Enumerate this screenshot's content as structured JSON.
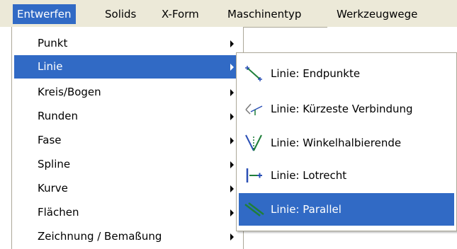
{
  "menubar": {
    "items": [
      {
        "label": "Entwerfen",
        "active": true
      },
      {
        "label": "Solids"
      },
      {
        "label": "X-Form"
      },
      {
        "label": "Maschinentyp"
      },
      {
        "label": "Werkzeugwege"
      }
    ]
  },
  "entwerfen_menu": {
    "items": [
      {
        "label": "Punkt",
        "has_submenu": true
      },
      {
        "label": "Linie",
        "has_submenu": true,
        "highlighted": true
      },
      {
        "label": "Kreis/Bogen",
        "has_submenu": true
      },
      {
        "label": "Runden",
        "has_submenu": true
      },
      {
        "label": "Fase",
        "has_submenu": true
      },
      {
        "label": "Spline",
        "has_submenu": true
      },
      {
        "label": "Kurve",
        "has_submenu": true
      },
      {
        "label": "Flächen",
        "has_submenu": true
      },
      {
        "label": "Zeichnung / Bemaßung",
        "has_submenu": true
      }
    ]
  },
  "linie_submenu": {
    "items": [
      {
        "label": "Linie: Endpunkte",
        "icon": "line-endpoints-icon"
      },
      {
        "label": "Linie: Kürzeste Verbindung",
        "icon": "line-shortest-connection-icon"
      },
      {
        "label": "Linie: Winkelhalbierende",
        "icon": "line-angle-bisector-icon"
      },
      {
        "label": "Linie: Lotrecht",
        "icon": "line-perpendicular-icon"
      },
      {
        "label": "Linie: Parallel",
        "icon": "line-parallel-icon",
        "highlighted": true
      }
    ]
  },
  "colors": {
    "menubar_bg": "#ece9d8",
    "highlight": "#316ac5",
    "menu_border": "#aca899",
    "icon_green": "#1f7f3a",
    "icon_blue": "#2a4fb5"
  }
}
